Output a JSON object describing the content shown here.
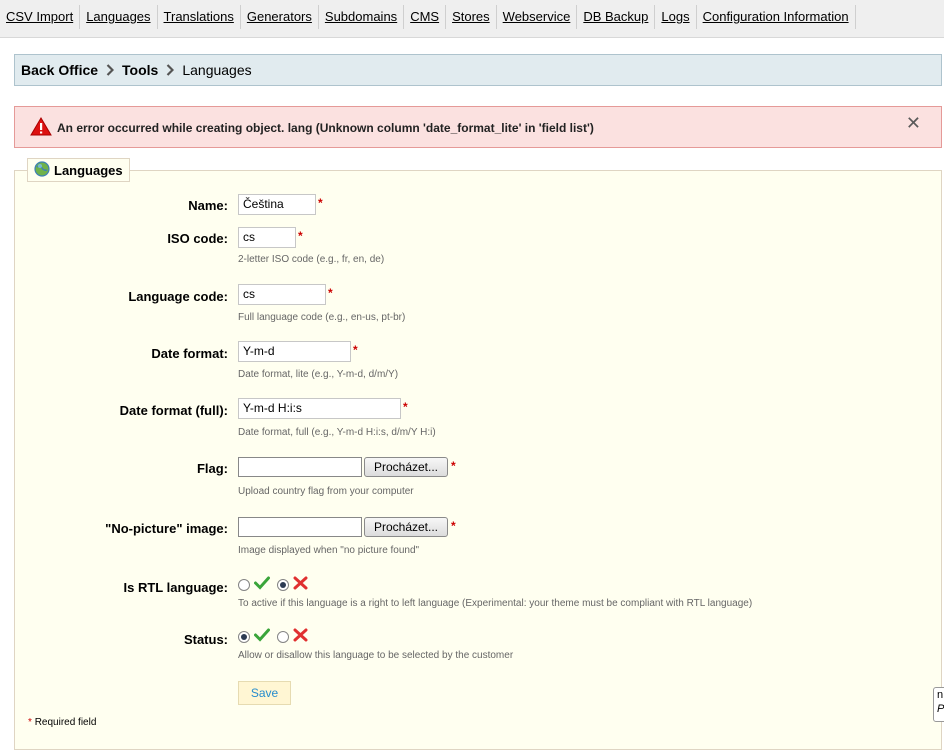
{
  "tabs": [
    "CSV Import",
    "Languages",
    "Translations",
    "Generators",
    "Subdomains",
    "CMS",
    "Stores",
    "Webservice",
    "DB Backup",
    "Logs",
    "Configuration Information"
  ],
  "breadcrumb": [
    "Back Office",
    "Tools",
    "Languages"
  ],
  "error": {
    "message": "An error occurred while creating object. lang (Unknown column 'date_format_lite' in 'field list')",
    "close": "✕"
  },
  "form": {
    "legend": "Languages",
    "fields": {
      "name": {
        "label": "Name:",
        "value": "Čeština"
      },
      "iso": {
        "label": "ISO code:",
        "value": "cs",
        "hint": "2-letter ISO code (e.g., fr, en, de)"
      },
      "language_code": {
        "label": "Language code:",
        "value": "cs",
        "hint": "Full language code (e.g., en-us, pt-br)"
      },
      "date_format": {
        "label": "Date format:",
        "value": "Y-m-d",
        "hint": "Date format, lite (e.g., Y-m-d, d/m/Y)"
      },
      "date_format_full": {
        "label": "Date format (full):",
        "value": "Y-m-d H:i:s",
        "hint": "Date format, full (e.g., Y-m-d H:i:s, d/m/Y H:i)"
      },
      "flag": {
        "label": "Flag:",
        "button": "Procházet...",
        "hint": "Upload country flag from your computer"
      },
      "no_picture": {
        "label": "\"No-picture\" image:",
        "button": "Procházet...",
        "hint": "Image displayed when \"no picture found\""
      },
      "rtl": {
        "label": "Is RTL language:",
        "selected": "no",
        "hint": "To active if this language is a right to left language (Experimental: your theme must be compliant with RTL language)"
      },
      "status": {
        "label": "Status:",
        "selected": "yes",
        "hint": "Allow or disallow this language to be selected by the customer"
      }
    },
    "required_mark": "*",
    "save_label": "Save",
    "required_note": "Required field"
  },
  "tooltip": {
    "line1": "n",
    "line2": "P"
  },
  "icons": {
    "alert": "warning-triangle-icon",
    "check": "green-check-icon",
    "cross": "red-cross-icon",
    "globe": "globe-icon",
    "chevron": "chevron-right-icon"
  },
  "colors": {
    "error_bg": "#fbe1e0",
    "error_border": "#e59a98",
    "fieldset_bg": "#fffff0",
    "breadcrumb_bg": "#e1ebef",
    "required": "#cc0000",
    "save_text": "#268ccd"
  }
}
